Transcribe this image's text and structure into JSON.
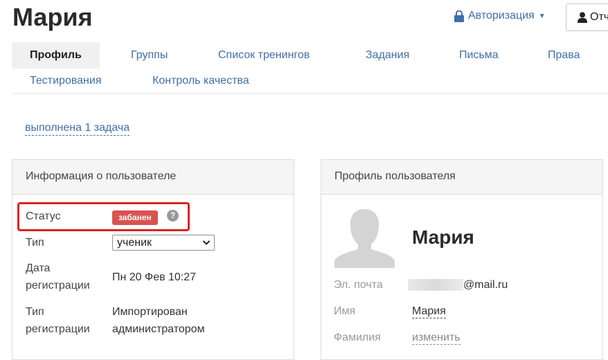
{
  "header": {
    "title": "Мария",
    "auth_label": "Авторизация",
    "report_label": "Отч"
  },
  "tabs": [
    {
      "label": "Профиль",
      "active": true
    },
    {
      "label": "Группы"
    },
    {
      "label": "Список тренингов"
    },
    {
      "label": "Задания"
    },
    {
      "label": "Письма"
    },
    {
      "label": "Права"
    },
    {
      "label": "Тестирования"
    },
    {
      "label": "Контроль качества"
    }
  ],
  "task_link": "выполнена 1 задача",
  "user_info": {
    "heading": "Информация о пользователе",
    "status_label": "Статус",
    "status_badge": "забанен",
    "help_glyph": "?",
    "type_label": "Тип",
    "type_value": "ученик",
    "reg_date_label_1": "Дата",
    "reg_date_label_2": "регистрации",
    "reg_date_value": "Пн 20 Фев 10:27",
    "reg_type_label_1": "Тип",
    "reg_type_label_2": "регистрации",
    "reg_type_value_1": "Импортирован",
    "reg_type_value_2": "администратором"
  },
  "profile": {
    "heading": "Профиль пользователя",
    "name": "Мария",
    "email_label": "Эл. почта",
    "email_value": "@mail.ru",
    "first_name_label": "Имя",
    "first_name_value": "Мария",
    "last_name_label": "Фамилия",
    "last_name_action": "изменить"
  },
  "colors": {
    "link": "#3f6ea8",
    "badge": "#d9534f",
    "highlight": "#e0211b"
  }
}
